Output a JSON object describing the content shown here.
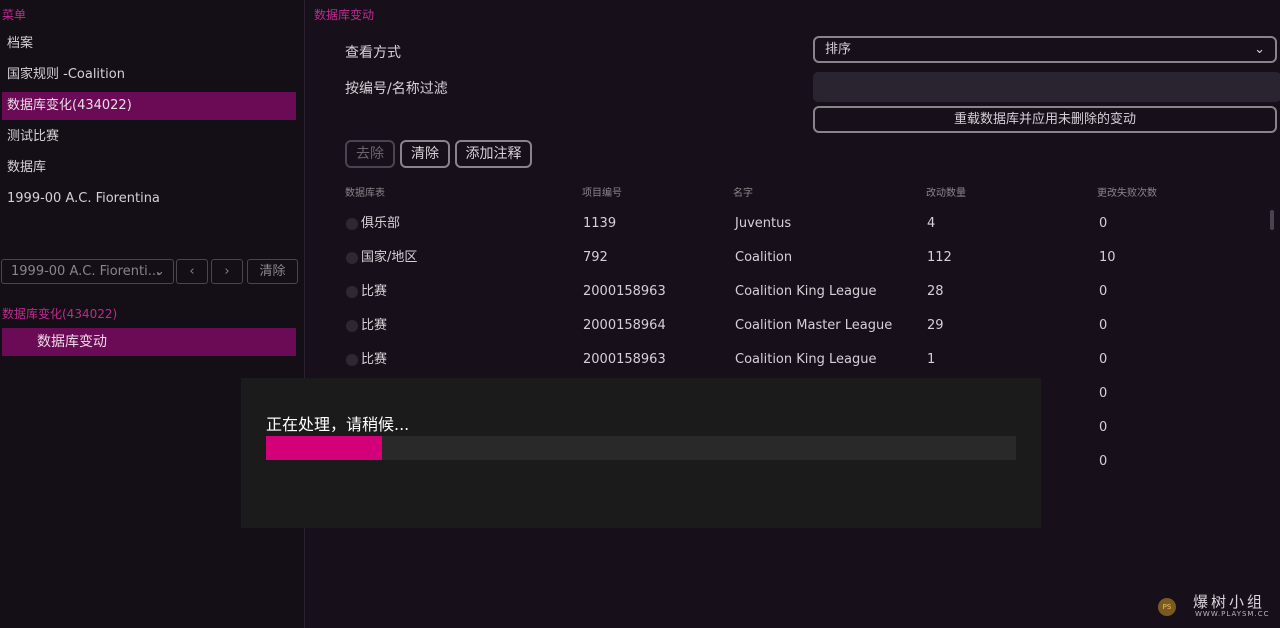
{
  "sidebar": {
    "menu_title": "菜单",
    "items": [
      {
        "label": "档案"
      },
      {
        "label": "国家规则 -Coalition"
      },
      {
        "label": "数据库变化(434022)"
      },
      {
        "label": "测试比赛"
      },
      {
        "label": "数据库"
      },
      {
        "label": "1999-00 A.C. Fiorentina"
      }
    ],
    "combo_value": "1999-00 A.C. Fiorenti...",
    "clear_label": "清除",
    "section_title": "数据库变化(434022)",
    "sub_item": "数据库变动"
  },
  "main": {
    "title": "数据库变动",
    "view_label": "查看方式",
    "view_value": "排序",
    "filter_label": "按编号/名称过滤",
    "filter_value": "",
    "reload_label": "重载数据库并应用未删除的变动",
    "buttons": {
      "remove": "去除",
      "clear": "清除",
      "add_note": "添加注释"
    },
    "columns": [
      "数据库表",
      "项目编号",
      "名字",
      "改动数量",
      "更改失败次数"
    ],
    "rows": [
      {
        "table": "俱乐部",
        "id": "1139",
        "name": "Juventus",
        "changes": "4",
        "fails": "0"
      },
      {
        "table": "国家/地区",
        "id": "792",
        "name": "Coalition",
        "changes": "112",
        "fails": "10"
      },
      {
        "table": "比赛",
        "id": "2000158963",
        "name": "Coalition King League",
        "changes": "28",
        "fails": "0"
      },
      {
        "table": "比赛",
        "id": "2000158964",
        "name": "Coalition Master League",
        "changes": "29",
        "fails": "0"
      },
      {
        "table": "比赛",
        "id": "2000158963",
        "name": "Coalition King League",
        "changes": "1",
        "fails": "0"
      },
      {
        "fails": "0"
      },
      {
        "fails": "0"
      },
      {
        "fails": "0"
      }
    ]
  },
  "dialog": {
    "message": "正在处理，请稍候...",
    "progress": 0.155
  },
  "watermark": {
    "title": "爆树小组",
    "url": "WWW.PLAYSM.CC",
    "badge": "PS"
  },
  "colors": {
    "accent": "#c0298f",
    "selected": "#6b0a55",
    "progress": "#d4007a"
  }
}
